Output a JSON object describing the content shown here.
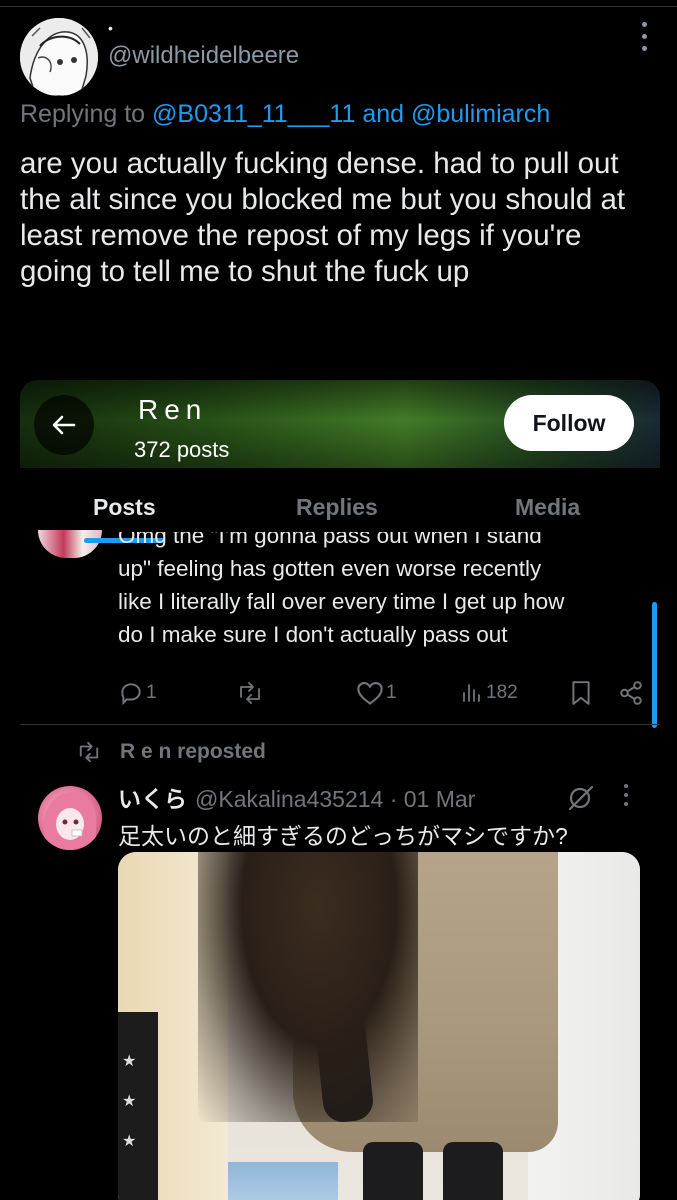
{
  "tweet": {
    "handle": "@wildheidelbeere",
    "dot": "•",
    "replying_prefix": "Replying to ",
    "replying_user1": "@B0311_11___11",
    "replying_and": " and ",
    "replying_user2": "@bulimiarch",
    "text": "are you actually fucking dense. had to pull out the alt since you blocked me but you should at least remove the repost of my legs if you're going to tell me to shut the fuck up"
  },
  "embed": {
    "profile": {
      "name": "Ren",
      "posts_count": "372 posts",
      "follow_label": "Follow"
    },
    "tabs": [
      {
        "label": "Posts",
        "active": true
      },
      {
        "label": "Replies",
        "active": false
      },
      {
        "label": "Media",
        "active": false
      }
    ],
    "previous_post": {
      "line1": "Omg the \"I'm gonna pass out when I stand",
      "line2": "up\" feeling has gotten even worse recently",
      "line3": "like I literally fall over every time I get up how",
      "line4": "do I make sure I don't actually pass out",
      "replies": "1",
      "reposts": "",
      "likes": "1",
      "views": "182"
    },
    "repost": {
      "label": "R e n reposted",
      "display_name": "いくら",
      "handle_time": "@Kakalina435214 · 01 Mar",
      "text": "足太いのと細すぎるのどっちがマシですか?"
    }
  },
  "colors": {
    "background": "#000000",
    "text": "#e7e9ea",
    "muted": "#71767b",
    "accent": "#1d9bf0"
  },
  "icons": [
    "more-options-icon",
    "back-arrow-icon",
    "reply-icon",
    "repost-icon",
    "like-icon",
    "views-icon",
    "bookmark-icon",
    "share-icon",
    "grok-icon"
  ]
}
